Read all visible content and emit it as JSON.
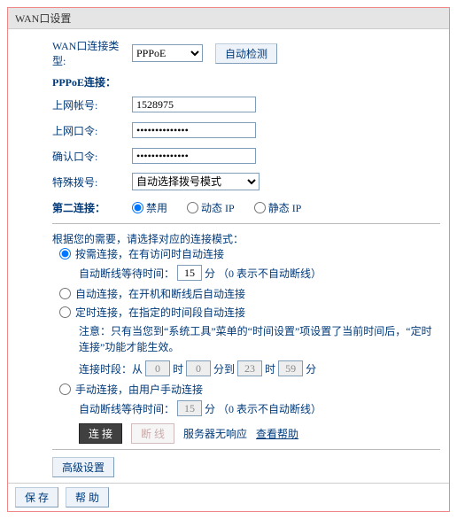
{
  "title": "WAN口设置",
  "labels": {
    "conn_type": "WAN口连接类型:",
    "auto_detect": "自动检测",
    "pppoe_section": "PPPoE连接：",
    "account": "上网帐号:",
    "password": "上网口令:",
    "confirm": "确认口令:",
    "special_dial": "特殊拨号:",
    "second_conn": "第二连接："
  },
  "conn_type": {
    "selected": "PPPoE"
  },
  "account_value": "1528975",
  "password_value": "••••••••••••••",
  "confirm_value": "••••••••••••••",
  "special_dial": {
    "selected": "自动选择拨号模式"
  },
  "second_conn_opts": {
    "disable": "禁用",
    "dyn": "动态 IP",
    "stat": "静态 IP"
  },
  "mode_intro": "根据您的需要，请选择对应的连接模式：",
  "modes": {
    "on_demand": "按需连接，在有访问时自动连接",
    "on_demand_sub_a": "自动断线等待时间：",
    "on_demand_sub_val": "15",
    "on_demand_sub_b": "分 （0 表示不自动断线）",
    "auto": "自动连接，在开机和断线后自动连接",
    "timed": "定时连接，在指定的时间段自动连接",
    "timed_note": "注意：只有当您到“系统工具”菜单的“时间设置”项设置了当前时间后，“定时连接”功能才能生效。",
    "timed_label": "连接时段：从",
    "t1h": "0",
    "t1m": "0",
    "t2h": "23",
    "t2m": "59",
    "unit_h": "时",
    "unit_m": "分",
    "to": "分到",
    "manual": "手动连接，由用户手动连接",
    "manual_sub_a": "自动断线等待时间：",
    "manual_sub_val": "15",
    "manual_sub_b": "分 （0 表示不自动断线）"
  },
  "buttons": {
    "connect": "连 接",
    "disconnect": "断 线",
    "advanced": "高级设置",
    "save": "保 存",
    "help": "帮 助"
  },
  "status": "服务器无响应",
  "help_link": "查看帮助"
}
